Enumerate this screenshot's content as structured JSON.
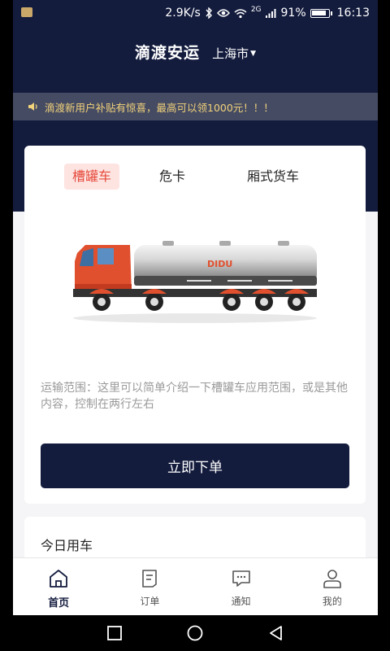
{
  "status_bar": {
    "network_speed": "2.9K/s",
    "network_type": "2G",
    "battery_percent": "91%",
    "battery_level": 0.91,
    "time": "16:13",
    "icons": [
      "bluetooth-icon",
      "eye-icon",
      "wifi-icon",
      "signal-icon",
      "battery-icon"
    ]
  },
  "header": {
    "title": "滴渡安运",
    "city": "上海市"
  },
  "notice": {
    "text": "滴渡新用户补贴有惊喜，最高可以领1000元！！！"
  },
  "vehicle_tabs": [
    {
      "label": "槽罐车",
      "active": true
    },
    {
      "label": "危卡",
      "active": false
    },
    {
      "label": "厢式货车",
      "active": false
    }
  ],
  "truck": {
    "brand_text": "DIDU"
  },
  "description": "运输范围：这里可以简单介绍一下槽罐车应用范围，或是其他内容，控制在两行左右",
  "order_button": "立即下单",
  "today_section": {
    "title": "今日用车"
  },
  "tab_bar": [
    {
      "label": "首页",
      "icon": "home-icon",
      "active": true
    },
    {
      "label": "订单",
      "icon": "order-icon",
      "active": false
    },
    {
      "label": "通知",
      "icon": "message-icon",
      "active": false
    },
    {
      "label": "我的",
      "icon": "user-icon",
      "active": false
    }
  ],
  "colors": {
    "primary": "#141c3e",
    "accent": "#e64a3c",
    "notice_text": "#f2d27a"
  }
}
